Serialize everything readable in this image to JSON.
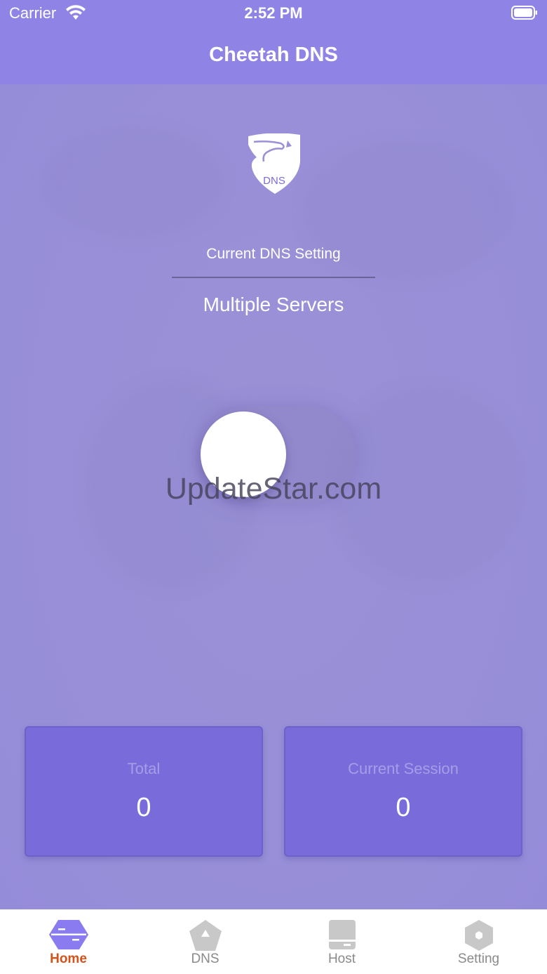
{
  "status_bar": {
    "carrier": "Carrier",
    "time": "2:52 PM"
  },
  "nav": {
    "title": "Cheetah DNS"
  },
  "logo": {
    "text": "DNS"
  },
  "dns": {
    "label": "Current DNS Setting",
    "value": "Multiple Servers"
  },
  "toggle": {
    "on": false
  },
  "watermark": "UpdateStar.com",
  "stats": [
    {
      "label": "Total",
      "value": "0"
    },
    {
      "label": "Current Session",
      "value": "0"
    }
  ],
  "tabs": [
    {
      "label": "Home",
      "icon": "home-hexagon-icon",
      "active": true
    },
    {
      "label": "DNS",
      "icon": "dns-pentagon-icon",
      "active": false
    },
    {
      "label": "Host",
      "icon": "host-server-icon",
      "active": false
    },
    {
      "label": "Setting",
      "icon": "setting-hexagon-icon",
      "active": false
    }
  ],
  "colors": {
    "nav": "#8f84e6",
    "background": "#9a90d8",
    "card": "#7a6bdb",
    "active_tab": "#d2531c",
    "inactive_tab": "#8a8a8a"
  }
}
